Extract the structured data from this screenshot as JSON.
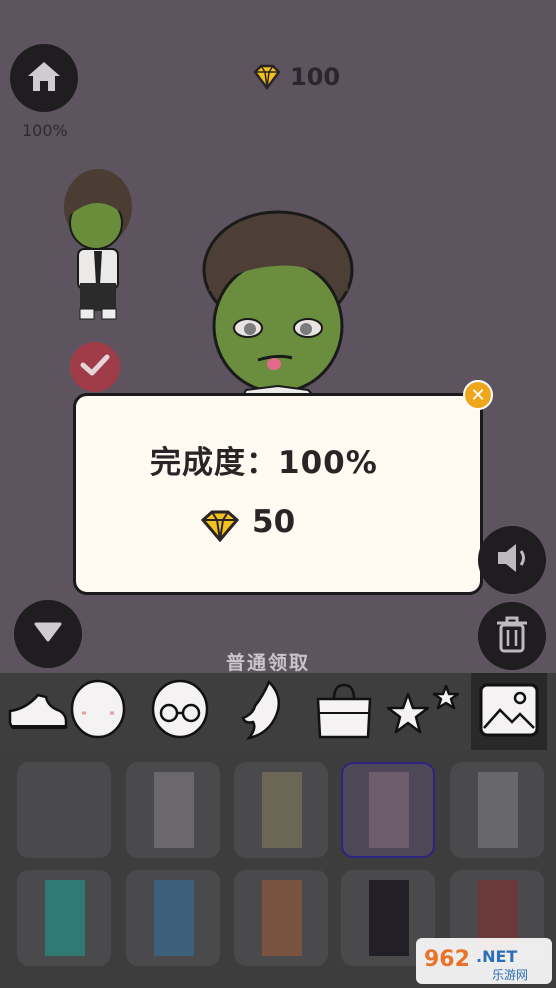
{
  "header": {
    "gem_count": "100",
    "progress": "100%"
  },
  "modal": {
    "completion_text": "完成度：100%",
    "reward_amount": "50"
  },
  "claim": {
    "label": "普通领取"
  },
  "toolbar": {
    "tabs": [
      {
        "name": "shoe"
      },
      {
        "name": "face"
      },
      {
        "name": "glasses"
      },
      {
        "name": "wing"
      },
      {
        "name": "bag"
      },
      {
        "name": "stars"
      },
      {
        "name": "background"
      }
    ]
  },
  "swatches": [
    {
      "color": ""
    },
    {
      "color": "#6a686b"
    },
    {
      "color": "#6b6655"
    },
    {
      "color": "#6d5d6d"
    },
    {
      "color": "#686769"
    },
    {
      "color": "#2f7a72"
    },
    {
      "color": "#3c6079"
    },
    {
      "color": "#7a5340"
    },
    {
      "color": "#231f26"
    },
    {
      "color": "#6a3a3a"
    }
  ],
  "watermark": {
    "brand": "962.NET",
    "sub": "乐游网"
  }
}
